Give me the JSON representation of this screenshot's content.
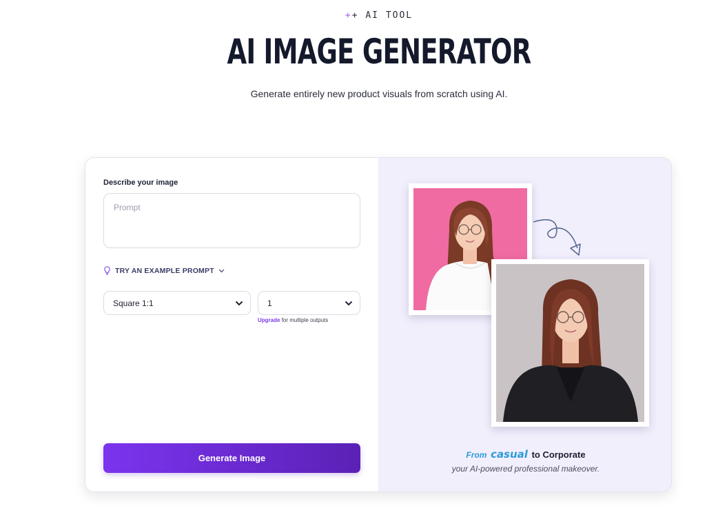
{
  "header": {
    "eyebrow_icon": "sparkle-icon",
    "eyebrow": "AI TOOL",
    "title": "AI IMAGE GENERATOR",
    "subtitle": "Generate entirely new product visuals from scratch using AI."
  },
  "form": {
    "label": "Describe your image",
    "prompt_value": "",
    "prompt_placeholder": "Prompt",
    "example_prompt_link": "TRY AN EXAMPLE PROMPT",
    "example_prompt_icon": "lightbulb-icon",
    "aspect_ratio": {
      "selected": "Square 1:1"
    },
    "output_count": {
      "selected": "1"
    },
    "upgrade_link": "Upgrade",
    "upgrade_note": "for multiple outputs",
    "generate_button": "Generate Image"
  },
  "showcase": {
    "caption_from": "From",
    "caption_casual": "casual",
    "caption_to": "to Corporate",
    "caption_sub": "your AI-powered professional makeover.",
    "colors": {
      "casual_background": "#f06ba2",
      "corporate_background": "#c9c3c6",
      "panel_background": "#f2effd"
    }
  },
  "colors": {
    "accent": "#7c3aed",
    "title": "#141a2b",
    "caption_accent": "#2b9bd6"
  }
}
